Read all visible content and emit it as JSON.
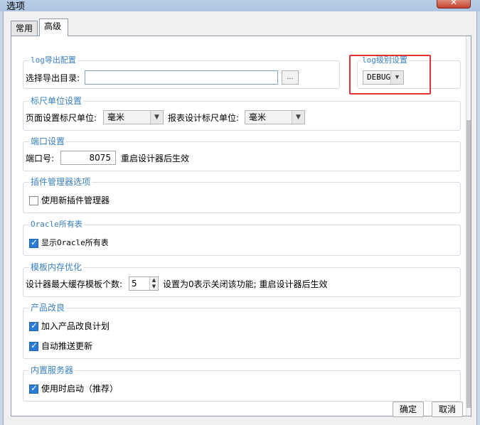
{
  "window": {
    "title": "选项"
  },
  "tabs": {
    "common": "常用",
    "advanced": "高级"
  },
  "log_export": {
    "title": "log导出配置",
    "dir_label": "选择导出目录:",
    "dir_value": "",
    "browse_label": "..."
  },
  "log_level": {
    "title": "log级别设置",
    "selected": "DEBUG"
  },
  "ruler": {
    "title": "标尺单位设置",
    "page_label": "页面设置标尺单位:",
    "page_value": "毫米",
    "report_label": "报表设计标尺单位:",
    "report_value": "毫米"
  },
  "port": {
    "title": "端口设置",
    "label": "端口号:",
    "value": "8075",
    "hint": "重启设计器后生效"
  },
  "plugin": {
    "title": "插件管理器选项",
    "option": "使用新插件管理器",
    "checked": false
  },
  "oracle": {
    "title": "Oracle所有表",
    "option": "显示Oracle所有表",
    "checked": true
  },
  "template_cache": {
    "title": "模板内存优化",
    "label": "设计器最大缓存模板个数:",
    "value": "5",
    "hint": "设置为0表示关闭该功能; 重启设计器后生效"
  },
  "product_improve": {
    "title": "产品改良",
    "join_plan": "加入产品改良计划",
    "join_checked": true,
    "auto_push": "自动推送更新",
    "auto_checked": true
  },
  "builtin_server": {
    "title": "内置服务器",
    "option": "使用时启动（推荐）",
    "checked": true
  },
  "footer": {
    "ok": "确定",
    "cancel": "取消"
  }
}
